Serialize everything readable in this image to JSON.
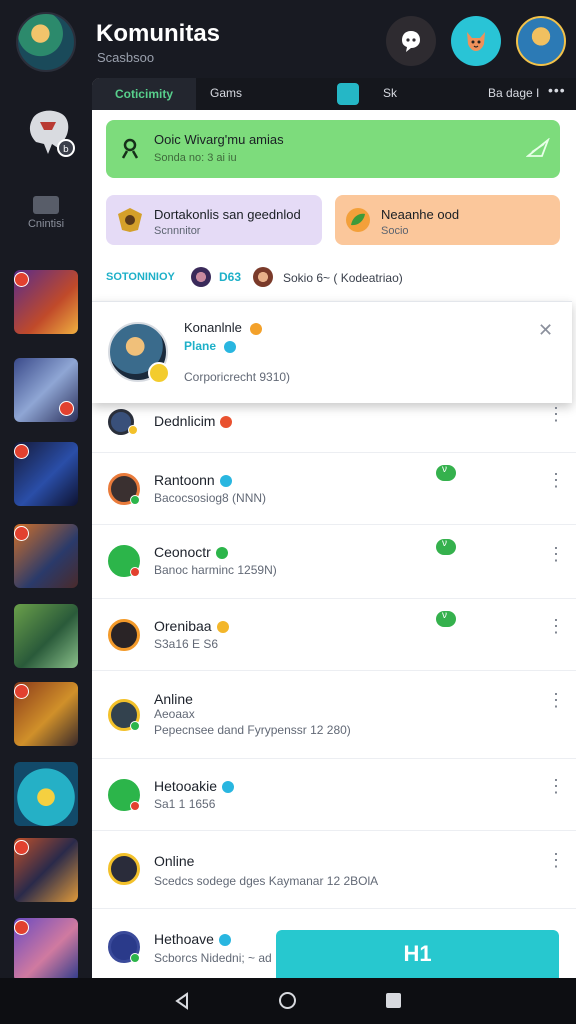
{
  "header": {
    "title": "Komunitas",
    "subtitle": "Scasbsoo"
  },
  "rail": {
    "label": "Cnintisi"
  },
  "tabs": {
    "active_label": "Coticimity",
    "game_label": "Gams",
    "sk_label": "Sk",
    "badge_label": "Ba dage I"
  },
  "banners": {
    "green_title": "Ooic Wivarg'mu amias",
    "green_sub": "Sonda no: 3 ai iu",
    "purple_title": "Dortakonlis san geednlod",
    "purple_sub": "Scnnnitor",
    "orange_title": "Neaanhe ood",
    "orange_sub": "Socio"
  },
  "section": {
    "label": "SOTONINIOY",
    "count": "D63",
    "info": "Sokio 6~ ( Kodeatriao)"
  },
  "popup": {
    "name": "Konanlnle",
    "role": "Plane",
    "detail": "Corporicrecht 9310)"
  },
  "rows": [
    {
      "name": "Dednlicim",
      "detail": ""
    },
    {
      "name": "Rantoonn",
      "detail": "Bacocsosiog8 (NNN)"
    },
    {
      "name": "Ceonoctr",
      "detail": "Banoc harminc 1259N)"
    },
    {
      "name": "Orenibaa",
      "detail": "S3a16 E S6"
    },
    {
      "name": "Anline",
      "detail": "Aeoaax",
      "detail2": "Pepecnsee dand Fyrypenssr 12 280)"
    },
    {
      "name": "Hetooakie",
      "detail": "Sa1 1 1656"
    },
    {
      "name": "Online",
      "detail": "Scedcs sodege dges Kaymanar 12 2BOlA"
    },
    {
      "name": "Hethoave",
      "detail": "Scborcs Nidedni; ~ ad"
    }
  ],
  "pills": {
    "label": "ν"
  },
  "fab": {
    "label": "H1"
  },
  "icons": {
    "notifications": "ghost-bubble-icon",
    "pet": "fox-mascot-icon",
    "profile": "profile-avatar-icon"
  },
  "colors": {
    "accent": "#27c8cf",
    "active_tab": "#58d08c",
    "section_label": "#1eb0c8"
  }
}
